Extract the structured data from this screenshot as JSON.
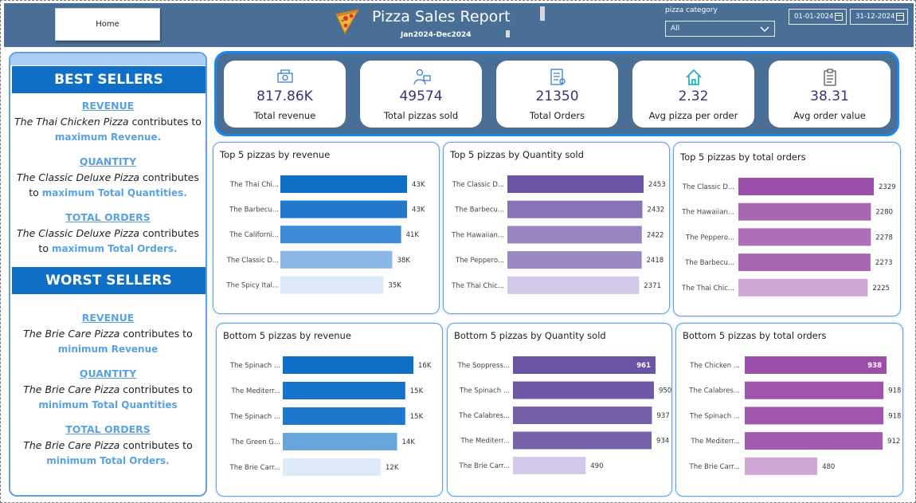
{
  "header": {
    "home_label": "Home",
    "title": "Pizza Sales Report",
    "subtitle": "Jan2024-Dec2024",
    "category_label": "pizza category",
    "category_value": "All",
    "date_start": "01-01-2024",
    "date_end": "31-12-2024"
  },
  "left_panel": {
    "best": {
      "heading": "BEST SELLERS",
      "items": [
        {
          "link": "REVENUE",
          "name": "The Thai Chicken Pizza",
          "verb": " contributes to",
          "metric": "maximum Revenue."
        },
        {
          "link": "QUANTITY",
          "name": "The Classic Deluxe Pizza",
          "verb": " contributes",
          "prefix": "to ",
          "metric": "maximum Total Quantities."
        },
        {
          "link": "TOTAL ORDERS",
          "name": "The Classic Deluxe Pizza",
          "verb": " contributes",
          "prefix": "to ",
          "metric": "maximum Total Orders."
        }
      ]
    },
    "worst": {
      "heading": "WORST SELLERS",
      "items": [
        {
          "link": "REVENUE",
          "name": "The Brie Care Pizza",
          "verb": " contributes to",
          "metric": "minimum Revenue"
        },
        {
          "link": "QUANTITY",
          "name": "The Brie Care Pizza",
          "verb": " contributes to",
          "metric": "minimum Total Quantities"
        },
        {
          "link": "TOTAL ORDERS",
          "name": "The Brie Care Pizza",
          "verb": " contributes to",
          "metric": "minimum Total Orders."
        }
      ]
    }
  },
  "kpis": [
    {
      "value": "817.86K",
      "label": "Total revenue",
      "icon": "money-icon"
    },
    {
      "value": "49574",
      "label": "Total pizzas sold",
      "icon": "delivery-person-icon"
    },
    {
      "value": "21350",
      "label": "Total Orders",
      "icon": "order-list-icon"
    },
    {
      "value": "2.32",
      "label": "Avg pizza per order",
      "icon": "home-icon"
    },
    {
      "value": "38.31",
      "label": "Avg order value",
      "icon": "clipboard-icon"
    }
  ],
  "chart_data": [
    {
      "type": "bar",
      "title": "Top 5 pizzas by revenue",
      "orientation": "horizontal",
      "categories": [
        "The Thai Chi...",
        "The Barbecu...",
        "The Californi...",
        "The Classic D...",
        "The Spicy Ital..."
      ],
      "values": [
        43000,
        43000,
        41000,
        38000,
        35000
      ],
      "labels": [
        "43K",
        "43K",
        "41K",
        "38K",
        "35K"
      ],
      "colors": [
        "#0f6fc6",
        "#2378cc",
        "#3b8bd8",
        "#8ab7e5",
        "#dbe9f8"
      ]
    },
    {
      "type": "bar",
      "title": "Top 5 pizzas by Quantity sold",
      "orientation": "horizontal",
      "categories": [
        "The Classic D...",
        "The Barbecu...",
        "The Hawaiian...",
        "The Peppero...",
        "The Thai Chic..."
      ],
      "values": [
        2453,
        2432,
        2422,
        2418,
        2371
      ],
      "labels": [
        "2453",
        "2432",
        "2422",
        "2418",
        "2371"
      ],
      "colors": [
        "#6b54a3",
        "#8a74b8",
        "#9985c2",
        "#9b89c3",
        "#d3c8ea"
      ]
    },
    {
      "type": "bar",
      "title": "Top 5 pizzas by total orders",
      "orientation": "horizontal",
      "categories": [
        "The Classic D...",
        "The Hawaiian...",
        "The Peppero...",
        "The Barbecu...",
        "The Thai Chic..."
      ],
      "values": [
        2329,
        2280,
        2278,
        2273,
        2225
      ],
      "labels": [
        "2329",
        "2280",
        "2278",
        "2273",
        "2225"
      ],
      "colors": [
        "#9b4fa8",
        "#a967b3",
        "#ad6fb7",
        "#a768b3",
        "#cfa8d5"
      ]
    },
    {
      "type": "bar",
      "title": "Bottom 5 pizzas by revenue",
      "orientation": "horizontal",
      "categories": [
        "The Spinach ...",
        "The Mediterr...",
        "The Spinach ...",
        "The Green G...",
        "The Brie Carr..."
      ],
      "values": [
        16000,
        15000,
        15000,
        14000,
        12000
      ],
      "labels": [
        "16K",
        "15K",
        "15K",
        "14K",
        "12K"
      ],
      "colors": [
        "#0f6fc6",
        "#1573cc",
        "#1d78cd",
        "#67a3dd",
        "#dceaf9"
      ]
    },
    {
      "type": "bar",
      "title": "Bottom 5 pizzas by Quantity sold",
      "orientation": "horizontal",
      "categories": [
        "The Soppress...",
        "The Spinach ...",
        "The Calabres...",
        "The Mediterr...",
        "The Brie Carr..."
      ],
      "values": [
        961,
        950,
        937,
        934,
        490
      ],
      "labels": [
        "961",
        "950",
        "937",
        "934",
        "490"
      ],
      "inside_first": true,
      "colors": [
        "#6b54a3",
        "#6f58a6",
        "#7560aa",
        "#7562aa",
        "#d3c8ea"
      ]
    },
    {
      "type": "bar",
      "title": "Bottom 5 pizzas by total orders",
      "orientation": "horizontal",
      "categories": [
        "The Chicken ...",
        "The Calabres...",
        "The Spinach ...",
        "The Mediterr...",
        "The Brie Carr..."
      ],
      "values": [
        938,
        918,
        918,
        912,
        480
      ],
      "labels": [
        "938",
        "918",
        "918",
        "912",
        "480"
      ],
      "inside_first": true,
      "colors": [
        "#9b4fa8",
        "#9f54ac",
        "#a057ad",
        "#a35bb0",
        "#cfa8d5"
      ]
    }
  ]
}
